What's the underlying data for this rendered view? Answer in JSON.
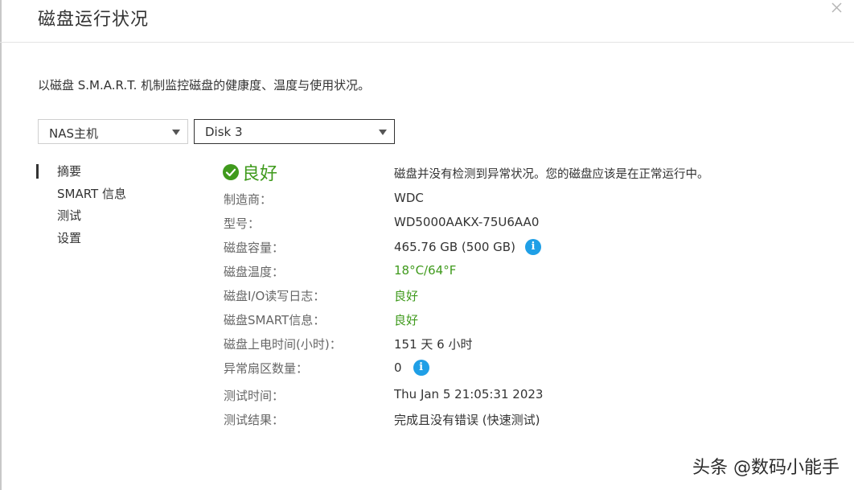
{
  "header": {
    "title": "磁盘运行状况"
  },
  "description": "以磁盘 S.M.A.R.T. 机制监控磁盘的健康度、温度与使用状况。",
  "selectors": {
    "nas": "NAS主机",
    "disk": "Disk 3"
  },
  "nav": [
    "摘要",
    "SMART 信息",
    "测试",
    "设置"
  ],
  "status": {
    "text": "良好",
    "description": "磁盘并没有检测到异常状况。您的磁盘应该是在正常运行中。"
  },
  "details": [
    {
      "label": "制造商：",
      "value": "WDC"
    },
    {
      "label": "型号：",
      "value": "WD5000AAKX-75U6AA0"
    },
    {
      "label": "磁盘容量：",
      "value": "465.76 GB (500 GB)"
    },
    {
      "label": "磁盘温度：",
      "value": "18°C/64°F"
    },
    {
      "label": "磁盘I/O读写日志：",
      "value": "良好"
    },
    {
      "label": "磁盘SMART信息：",
      "value": "良好"
    },
    {
      "label": "磁盘上电时间(小时)：",
      "value": "151 天 6 小时"
    },
    {
      "label": "异常扇区数量：",
      "value": "0"
    },
    {
      "label": "测试时间：",
      "value": "Thu Jan 5 21:05:31 2023"
    },
    {
      "label": "测试结果：",
      "value": "完成且没有错误 (快速测试)"
    }
  ],
  "watermark": "头条 @数码小能手",
  "colors": {
    "good": "#3f9a1c",
    "info": "#1f9fe6"
  },
  "icons": {
    "status": "check-circle-icon",
    "info": "info-icon",
    "close": "close-icon"
  }
}
